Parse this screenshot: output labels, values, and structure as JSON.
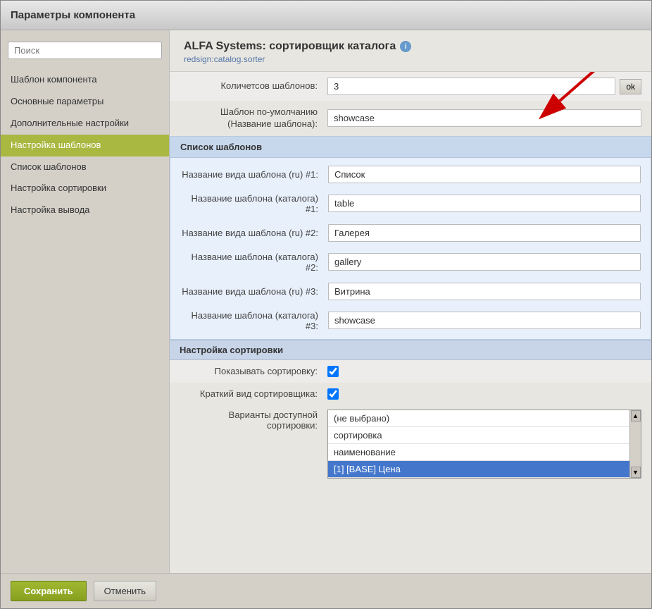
{
  "window": {
    "title": "Параметры компонента"
  },
  "sidebar": {
    "search_placeholder": "Поиск",
    "items": [
      {
        "label": "Шаблон компонента",
        "active": false
      },
      {
        "label": "Основные параметры",
        "active": false
      },
      {
        "label": "Дополнительные настройки",
        "active": false
      },
      {
        "label": "Настройка шаблонов",
        "active": true
      },
      {
        "label": "Список шаблонов",
        "active": false
      },
      {
        "label": "Настройка сортировки",
        "active": false
      },
      {
        "label": "Настройка вывода",
        "active": false
      }
    ]
  },
  "main": {
    "title": "ALFA Systems: сортировщик каталога",
    "subtitle": "redsign:catalog.sorter",
    "form": {
      "templates_count_label": "Количетсов шаблонов:",
      "templates_count_value": "3",
      "templates_count_ok": "ok",
      "default_template_label": "Шаблон по-умолчанию (Название шаблона):",
      "default_template_value": "showcase"
    },
    "template_list": {
      "section_label": "Список шаблонов",
      "items": [
        {
          "label": "Название вида шаблона (ru) #1:",
          "value": "Список"
        },
        {
          "label": "Название шаблона (каталога) #1:",
          "value": "table"
        },
        {
          "label": "Название вида шаблона (ru) #2:",
          "value": "Галерея"
        },
        {
          "label": "Название шаблона (каталога) #2:",
          "value": "gallery"
        },
        {
          "label": "Название вида шаблона (ru) #3:",
          "value": "Витрина"
        },
        {
          "label": "Название шаблона (каталога) #3:",
          "value": "showcase"
        }
      ]
    },
    "sort_settings": {
      "section_label": "Настройка сортировки",
      "show_sort_label": "Показывать сортировку:",
      "show_sort_checked": true,
      "compact_sort_label": "Краткий вид сортировщика:",
      "compact_sort_checked": true,
      "sort_variants_label": "Варианты доступной сортировки:",
      "dropdown_options": [
        {
          "label": "(не выбрано)",
          "selected": false
        },
        {
          "label": "сортировка",
          "selected": false
        },
        {
          "label": "наименование",
          "selected": false
        },
        {
          "label": "[1] [BASE] Цена",
          "selected": true
        }
      ]
    }
  },
  "footer": {
    "save_label": "Сохранить",
    "cancel_label": "Отменить"
  }
}
